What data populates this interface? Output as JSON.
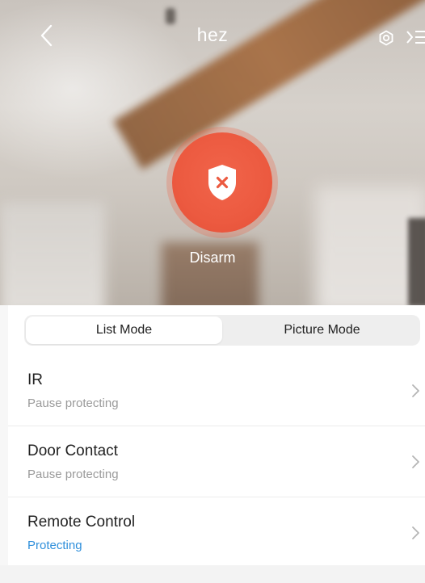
{
  "header": {
    "title": "hez",
    "back_icon": "chevron-left-icon",
    "settings_icon": "settings-hex-icon",
    "menu_icon": "list-menu-icon"
  },
  "arm_control": {
    "icon": "shield-x-icon",
    "label": "Disarm",
    "color": "#EC5A40"
  },
  "mode_tabs": [
    {
      "label": "List Mode",
      "active": true
    },
    {
      "label": "Picture Mode",
      "active": false
    }
  ],
  "devices": [
    {
      "name": "IR",
      "status": "Pause protecting",
      "status_color": "#9A9A9A"
    },
    {
      "name": "Door Contact",
      "status": "Pause protecting",
      "status_color": "#9A9A9A"
    },
    {
      "name": "Remote Control",
      "status": "Protecting",
      "status_color": "#2F8FDB"
    }
  ]
}
